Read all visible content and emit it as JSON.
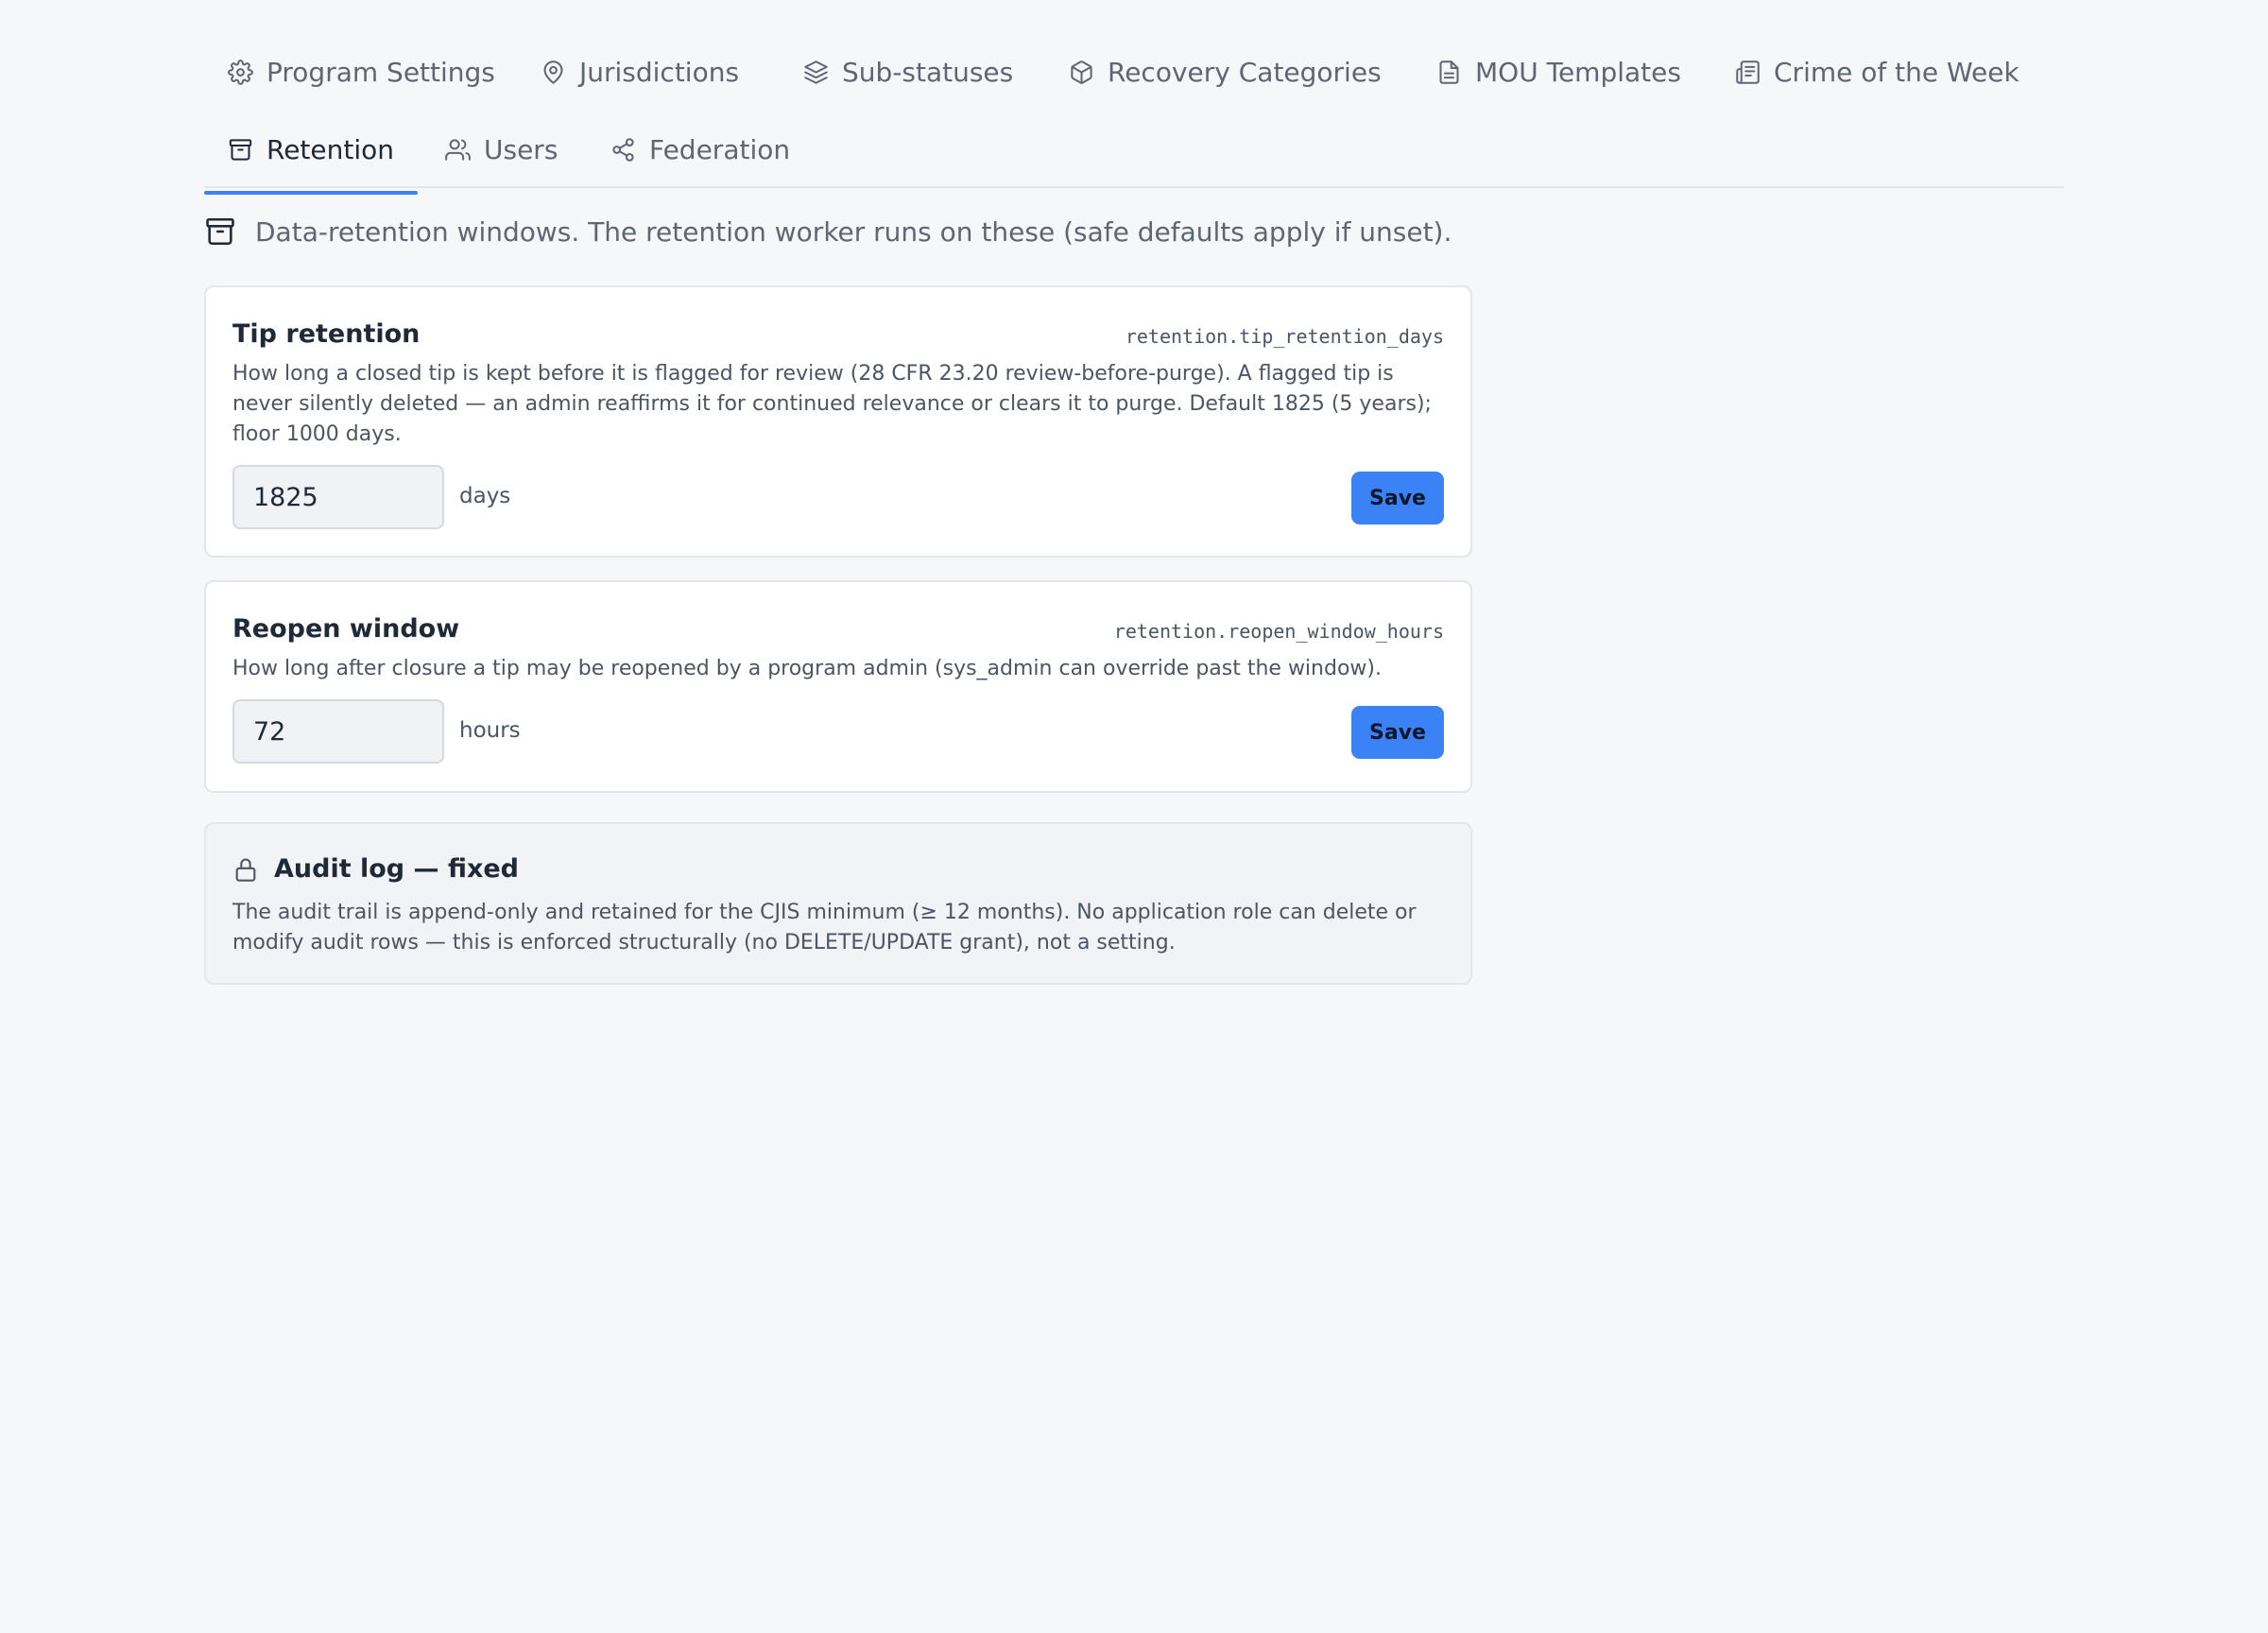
{
  "tabs": [
    {
      "label": "Program Settings",
      "icon": "gear-icon"
    },
    {
      "label": "Jurisdictions",
      "icon": "map-pin-icon"
    },
    {
      "label": "Sub-statuses",
      "icon": "layers-icon"
    },
    {
      "label": "Recovery Categories",
      "icon": "package-icon"
    },
    {
      "label": "MOU Templates",
      "icon": "document-icon"
    },
    {
      "label": "Crime of the Week",
      "icon": "newspaper-icon"
    },
    {
      "label": "Retention",
      "icon": "archive-icon",
      "active": true
    },
    {
      "label": "Users",
      "icon": "users-icon"
    },
    {
      "label": "Federation",
      "icon": "share-icon"
    }
  ],
  "intro": {
    "icon": "archive-icon",
    "text": "Data-retention windows. The retention worker runs on these (safe defaults apply if unset)."
  },
  "cards": [
    {
      "title": "Tip retention",
      "key": "retention.tip_retention_days",
      "description": "How long a closed tip is kept before it is flagged for review (28 CFR 23.20 review-before-purge). A flagged tip is never silently deleted — an admin reaffirms it for continued relevance or clears it to purge. Default 1825 (5 years); floor 1000 days.",
      "value": "1825",
      "unit": "days",
      "save_label": "Save"
    },
    {
      "title": "Reopen window",
      "key": "retention.reopen_window_hours",
      "description": "How long after closure a tip may be reopened by a program admin (sys_admin can override past the window).",
      "value": "72",
      "unit": "hours",
      "save_label": "Save"
    }
  ],
  "audit": {
    "icon": "lock-icon",
    "title": "Audit log — fixed",
    "description": "The audit trail is append-only and retained for the CJIS minimum (≥ 12 months). No application role can delete or modify audit rows — this is enforced structurally (no DELETE/UPDATE grant), not a setting."
  },
  "colors": {
    "accent": "#3b82f6",
    "background": "#f5f7f9"
  }
}
